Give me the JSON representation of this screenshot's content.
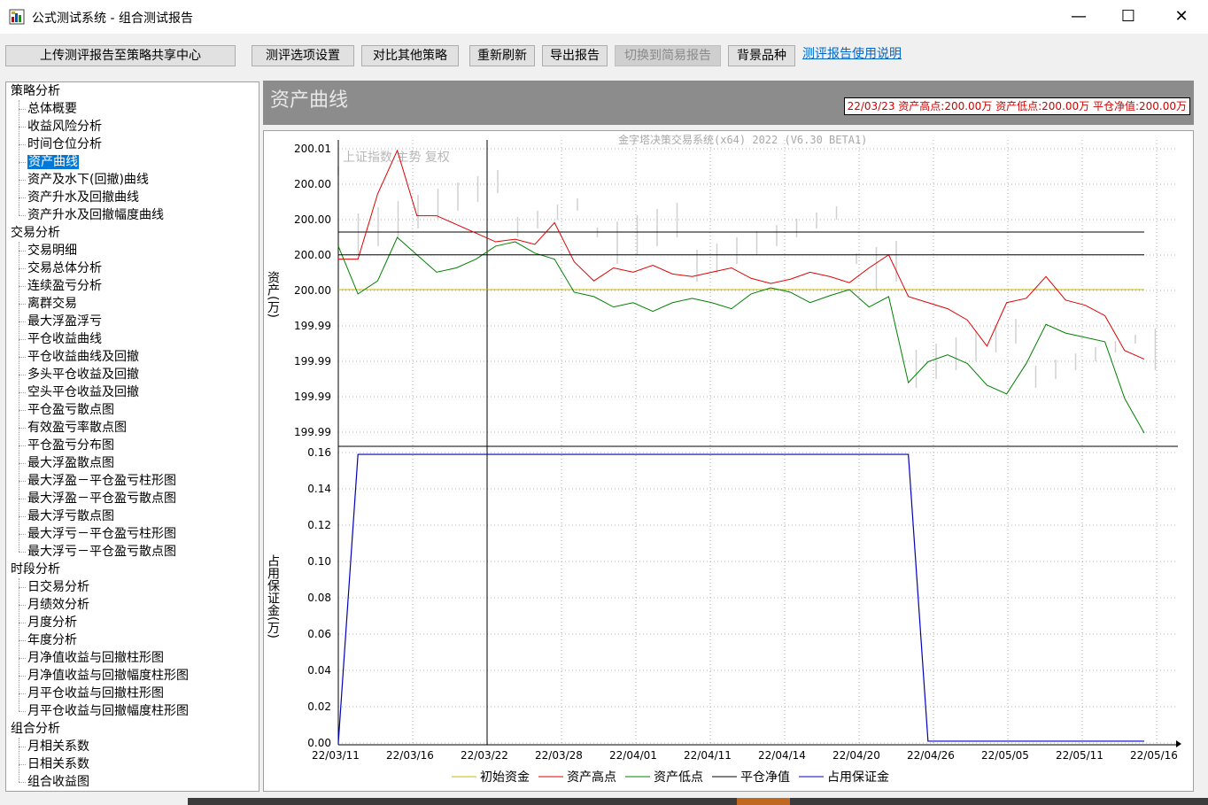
{
  "window": {
    "title": "公式测试系统 - 组合测试报告",
    "minimize": "—",
    "maximize": "☐",
    "close": "✕"
  },
  "toolbar": {
    "upload": "上传测评报告至策略共享中心",
    "options": "测评选项设置",
    "compare": "对比其他策略",
    "refresh": "重新刷新",
    "export": "导出报告",
    "switch_simple": "切换到简易报告",
    "bg_symbol": "背景品种",
    "help": "测评报告使用说明"
  },
  "tree": {
    "groups": [
      {
        "label": "策略分析",
        "items": [
          "总体概要",
          "收益风险分析",
          "时间仓位分析",
          "资产曲线",
          "资产及水下(回撤)曲线",
          "资产升水及回撤曲线",
          "资产升水及回撤幅度曲线"
        ]
      },
      {
        "label": "交易分析",
        "items": [
          "交易明细",
          "交易总体分析",
          "连续盈亏分析",
          "离群交易",
          "最大浮盈浮亏",
          "平仓收益曲线",
          "平仓收益曲线及回撤",
          "多头平仓收益及回撤",
          "空头平仓收益及回撤",
          "平仓盈亏散点图",
          "有效盈亏率散点图",
          "平仓盈亏分布图",
          "最大浮盈散点图",
          "最大浮盈－平仓盈亏柱形图",
          "最大浮盈－平仓盈亏散点图",
          "最大浮亏散点图",
          "最大浮亏－平仓盈亏柱形图",
          "最大浮亏－平仓盈亏散点图"
        ]
      },
      {
        "label": "时段分析",
        "items": [
          "日交易分析",
          "月绩效分析",
          "月度分析",
          "年度分析",
          "月净值收益与回撤柱形图",
          "月净值收益与回撤幅度柱形图",
          "月平仓收益与回撤柱形图",
          "月平仓收益与回撤幅度柱形图"
        ]
      },
      {
        "label": "组合分析",
        "items": [
          "月相关系数",
          "日相关系数",
          "组合收益图"
        ]
      }
    ],
    "selected": "资产曲线"
  },
  "panel": {
    "title": "资产曲线",
    "info": "22/03/23 资产高点:200.00万  资产低点:200.00万  平仓净值:200.00万"
  },
  "colors": {
    "initial": "#c8b400",
    "high": "#e00000",
    "low": "#008000",
    "net": "#000000",
    "margin": "#0000c0",
    "bg_bars": "#d0d0d0",
    "grid": "#b0b0b0"
  },
  "chart_data": {
    "type": "line",
    "watermark": "金字塔决策交易系统(x64) 2022 (V6.30 BETA1)",
    "background_label": "上证指数 主势 复权",
    "x": [
      "22/03/11",
      "22/03/14",
      "22/03/15",
      "22/03/16",
      "22/03/17",
      "22/03/18",
      "22/03/21",
      "22/03/22",
      "22/03/23",
      "22/03/24",
      "22/03/25",
      "22/03/28",
      "22/03/29",
      "22/03/30",
      "22/03/31",
      "22/04/01",
      "22/04/06",
      "22/04/07",
      "22/04/08",
      "22/04/11",
      "22/04/12",
      "22/04/13",
      "22/04/14",
      "22/04/15",
      "22/04/18",
      "22/04/19",
      "22/04/20",
      "22/04/21",
      "22/04/22",
      "22/04/25",
      "22/04/26",
      "22/04/27",
      "22/04/28",
      "22/04/29",
      "22/05/05",
      "22/05/06",
      "22/05/09",
      "22/05/10",
      "22/05/11",
      "22/05/12",
      "22/05/13",
      "22/05/16"
    ],
    "x_tick_labels": [
      "22/03/11",
      "22/03/16",
      "22/03/22",
      "22/03/28",
      "22/04/01",
      "22/04/11",
      "22/04/14",
      "22/04/20",
      "22/04/26",
      "22/05/05",
      "22/05/11",
      "22/05/16"
    ],
    "upper": {
      "ylabel": "资产(万)",
      "tick_labels": [
        "200.01",
        "200.00",
        "200.00",
        "200.00",
        "200.00",
        "199.99",
        "199.99",
        "199.99",
        "199.99"
      ],
      "series": [
        {
          "name": "初始资金",
          "color_key": "initial",
          "values": [
            200.0,
            200.0,
            200.0,
            200.0,
            200.0,
            200.0,
            200.0,
            200.0,
            200.0,
            200.0,
            200.0,
            200.0,
            200.0,
            200.0,
            200.0,
            200.0,
            200.0,
            200.0,
            200.0,
            200.0,
            200.0,
            200.0,
            200.0,
            200.0,
            200.0,
            200.0,
            200.0,
            200.0,
            200.0,
            200.0,
            200.0,
            200.0,
            200.0,
            200.0,
            200.0,
            200.0,
            200.0,
            200.0,
            200.0,
            200.0,
            200.0,
            200.0
          ]
        },
        {
          "name": "资产高点",
          "color_key": "high",
          "values": [
            200.0035,
            200.0035,
            200.011,
            200.016,
            200.0085,
            200.0085,
            200.0075,
            200.0065,
            200.0055,
            200.0058,
            200.0052,
            200.0077,
            200.0032,
            200.001,
            200.0025,
            200.002,
            200.0028,
            200.0018,
            200.0015,
            200.002,
            200.0025,
            200.0013,
            200.0007,
            200.0012,
            200.002,
            200.0015,
            200.0008,
            200.0025,
            200.004,
            199.9992,
            199.9985,
            199.9978,
            199.9965,
            199.9935,
            199.9985,
            199.999,
            200.0015,
            199.9988,
            199.9982,
            199.997,
            199.993,
            199.992
          ]
        },
        {
          "name": "资产低点",
          "color_key": "low",
          "values": [
            200.005,
            199.9995,
            200.001,
            200.006,
            200.004,
            200.002,
            200.0025,
            200.0035,
            200.005,
            200.0055,
            200.0042,
            200.0035,
            199.9997,
            199.9992,
            199.998,
            199.9985,
            199.9975,
            199.9985,
            199.999,
            199.9985,
            199.9978,
            199.9995,
            200.0002,
            199.9997,
            199.9985,
            199.9993,
            200.0,
            199.998,
            199.9992,
            199.9893,
            199.9917,
            199.9925,
            199.9915,
            199.989,
            199.988,
            199.9915,
            199.996,
            199.995,
            199.9945,
            199.994,
            199.9875,
            199.9835
          ]
        },
        {
          "name": "平仓净值",
          "color_key": "net",
          "values": [
            200.004,
            200.004,
            200.004,
            200.004,
            200.004,
            200.004,
            200.004,
            200.004,
            200.004,
            200.004,
            200.004,
            200.004,
            200.004,
            200.004,
            200.004,
            200.004,
            200.004,
            200.004,
            200.004,
            200.004,
            200.004,
            200.004,
            200.004,
            200.004,
            200.004,
            200.004,
            200.004,
            200.004,
            200.004,
            200.004,
            200.004,
            200.004,
            200.004,
            200.004,
            200.004,
            200.004,
            200.004,
            200.004,
            200.004,
            200.004,
            200.004,
            200.004
          ]
        }
      ]
    },
    "lower": {
      "ylabel": "占用保证金(万)",
      "ylim": [
        0,
        0.16
      ],
      "ticks": [
        0.0,
        0.02,
        0.04,
        0.06,
        0.08,
        0.1,
        0.12,
        0.14,
        0.16
      ],
      "tick_labels": [
        "0.00",
        "0.02",
        "0.04",
        "0.06",
        "0.08",
        "0.10",
        "0.12",
        "0.14",
        "0.16"
      ],
      "series": [
        {
          "name": "占用保证金",
          "color_key": "margin",
          "values": [
            0.0,
            0.159,
            0.159,
            0.159,
            0.159,
            0.159,
            0.159,
            0.159,
            0.159,
            0.159,
            0.159,
            0.159,
            0.159,
            0.159,
            0.159,
            0.159,
            0.159,
            0.159,
            0.159,
            0.159,
            0.159,
            0.159,
            0.159,
            0.159,
            0.159,
            0.159,
            0.159,
            0.159,
            0.159,
            0.159,
            0.001,
            0.001,
            0.001,
            0.001,
            0.001,
            0.001,
            0.001,
            0.001,
            0.001,
            0.001,
            0.001,
            0.001
          ]
        }
      ]
    },
    "legend": [
      {
        "name": "初始资金",
        "color_key": "initial"
      },
      {
        "name": "资产高点",
        "color_key": "high"
      },
      {
        "name": "资产低点",
        "color_key": "low"
      },
      {
        "name": "平仓净值",
        "color_key": "net"
      },
      {
        "name": "占用保证金",
        "color_key": "margin"
      }
    ]
  }
}
